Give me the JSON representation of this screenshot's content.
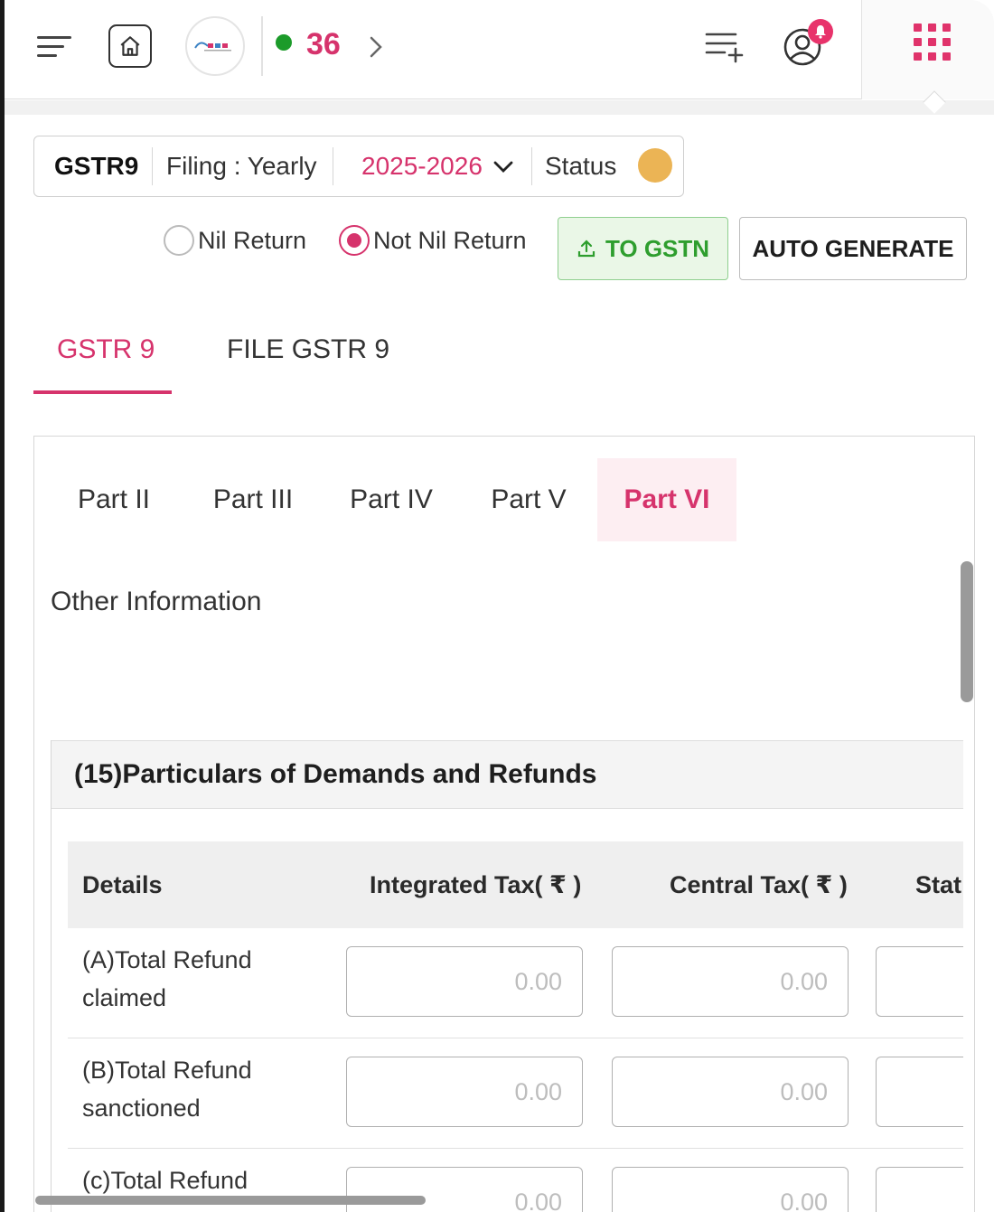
{
  "topbar": {
    "notification_count": "36",
    "colors": {
      "accent": "#d6336c",
      "online": "#1c9b2a"
    },
    "icons": [
      "menu-icon",
      "home-icon",
      "company-logo",
      "chevron-right-icon",
      "playlist-add-icon",
      "user-icon",
      "bell-icon",
      "apps-grid-icon"
    ]
  },
  "filing": {
    "form": "GSTR9",
    "filing_type": "Filing : Yearly",
    "year": "2025-2026",
    "status_label": "Status",
    "status_color": "#ebb455"
  },
  "return_type": {
    "options": [
      "Nil Return",
      "Not Nil Return"
    ],
    "selected": "Not Nil Return"
  },
  "actions": {
    "to_gstn": "TO GSTN",
    "auto_generate": "AUTO GENERATE"
  },
  "main_tabs": [
    {
      "label": "GSTR 9",
      "active": true
    },
    {
      "label": "FILE GSTR 9",
      "active": false
    }
  ],
  "part_tabs": [
    {
      "label": "Part II",
      "active": false
    },
    {
      "label": "Part III",
      "active": false
    },
    {
      "label": "Part IV",
      "active": false
    },
    {
      "label": "Part V",
      "active": false
    },
    {
      "label": "Part VI",
      "active": true
    }
  ],
  "content": {
    "heading": "Other Information",
    "section_title": "(15)Particulars of Demands and Refunds",
    "table": {
      "columns": [
        "Details",
        "Integrated Tax( ₹ )",
        "Central Tax( ₹ )",
        "Stat"
      ],
      "rows": [
        {
          "label": "(A)Total Refund claimed",
          "values": [
            "0.00",
            "0.00",
            ""
          ]
        },
        {
          "label": "(B)Total Refund sanctioned",
          "values": [
            "0.00",
            "0.00",
            ""
          ]
        },
        {
          "label": "(c)Total Refund",
          "values": [
            "0.00",
            "0.00",
            ""
          ]
        }
      ]
    }
  }
}
